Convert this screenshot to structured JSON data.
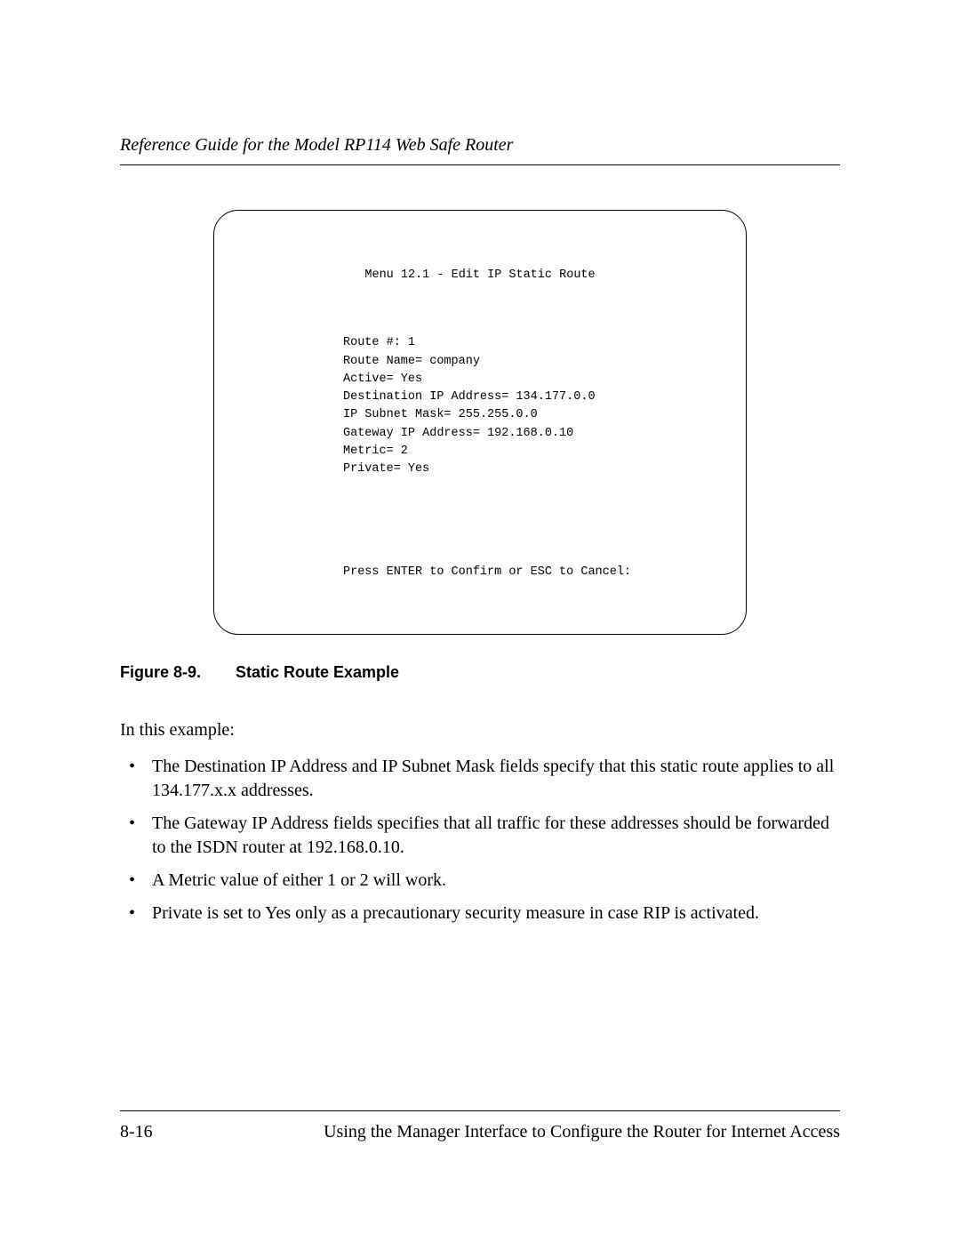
{
  "header": {
    "running_title": "Reference Guide for the Model RP114 Web Safe Router"
  },
  "terminal": {
    "title": "Menu 12.1 - Edit IP Static Route",
    "lines": {
      "route_num": "Route #: 1",
      "route_name": "Route Name= company",
      "active": "Active= Yes",
      "dest_ip": "Destination IP Address= 134.177.0.0",
      "subnet": "IP Subnet Mask= 255.255.0.0",
      "gateway": "Gateway IP Address= 192.168.0.10",
      "metric": "Metric= 2",
      "private": "Private= Yes"
    },
    "footer": "Press ENTER to Confirm or ESC to Cancel:"
  },
  "figure": {
    "number": "Figure 8-9.",
    "title": "Static Route Example"
  },
  "intro": "In this example:",
  "bullets": [
    "The Destination IP Address and IP Subnet Mask fields specify that this static route applies to all 134.177.x.x addresses.",
    "The Gateway IP Address fields specifies that all traffic for these addresses should be forwarded to the ISDN router at 192.168.0.10.",
    "A Metric value of either 1 or 2 will work.",
    "Private is set to Yes only as a precautionary security measure in case RIP is activated."
  ],
  "footer": {
    "page_num": "8-16",
    "section": "Using the Manager Interface to Configure the Router for Internet Access"
  }
}
